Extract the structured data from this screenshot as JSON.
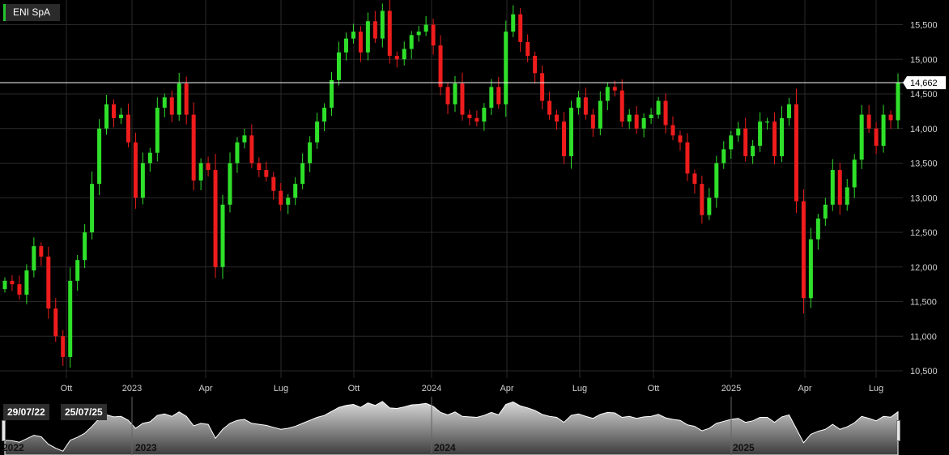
{
  "badge": {
    "title": "ENI SpA",
    "accent": "#22c32e"
  },
  "navigator": {
    "start_date": "29/07/22",
    "end_date": "25/07/25",
    "year_labels": [
      "2022",
      "2023",
      "2024",
      "2025"
    ]
  },
  "colors": {
    "up": "#2fe02a",
    "down": "#ee1c1c",
    "background": "#000000",
    "grid": "#2a2a2a",
    "price_line": "#ffffff"
  },
  "chart_data": {
    "type": "candlestick",
    "title": "ENI SpA",
    "ylim": [
      10400,
      15850
    ],
    "y_ticks": [
      "10,500",
      "11,000",
      "11,500",
      "12,000",
      "12,500",
      "13,000",
      "13,500",
      "14,000",
      "14,500",
      "15,000",
      "15,500"
    ],
    "x_ticks": [
      "Ott",
      "2023",
      "Apr",
      "Lug",
      "Ott",
      "2024",
      "Apr",
      "Lug",
      "Ott",
      "2025",
      "Apr",
      "Lug"
    ],
    "last_price": "14,662",
    "grid": true,
    "weekly_closes": [
      11800,
      11750,
      11600,
      11950,
      12300,
      12150,
      11400,
      11000,
      10700,
      11800,
      12100,
      12500,
      13200,
      14000,
      14350,
      14150,
      14200,
      13800,
      13000,
      13500,
      13650,
      14300,
      14450,
      14200,
      14650,
      14200,
      13250,
      13500,
      13400,
      12000,
      12900,
      13500,
      13800,
      13900,
      13500,
      13400,
      13300,
      13100,
      12900,
      13000,
      13200,
      13500,
      13800,
      14100,
      14300,
      14700,
      15100,
      15300,
      15400,
      15100,
      15550,
      15300,
      15700,
      15050,
      15000,
      15150,
      15350,
      15400,
      15500,
      15200,
      14600,
      14350,
      14650,
      14200,
      14150,
      14100,
      14300,
      14600,
      14350,
      15400,
      15650,
      15250,
      15050,
      14800,
      14400,
      14200,
      14100,
      13600,
      14300,
      14450,
      14200,
      14000,
      14400,
      14600,
      14550,
      14100,
      14200,
      14000,
      14150,
      14200,
      14400,
      14050,
      13900,
      13800,
      13350,
      13200,
      12750,
      13000,
      13500,
      13700,
      13900,
      14000,
      13600,
      13750,
      14100,
      14100,
      13600,
      14150,
      14350,
      12950,
      11550,
      12400,
      12700,
      12900,
      13400,
      12900,
      13150,
      13550,
      14200,
      14000,
      13750,
      14200,
      14120,
      14662
    ]
  }
}
